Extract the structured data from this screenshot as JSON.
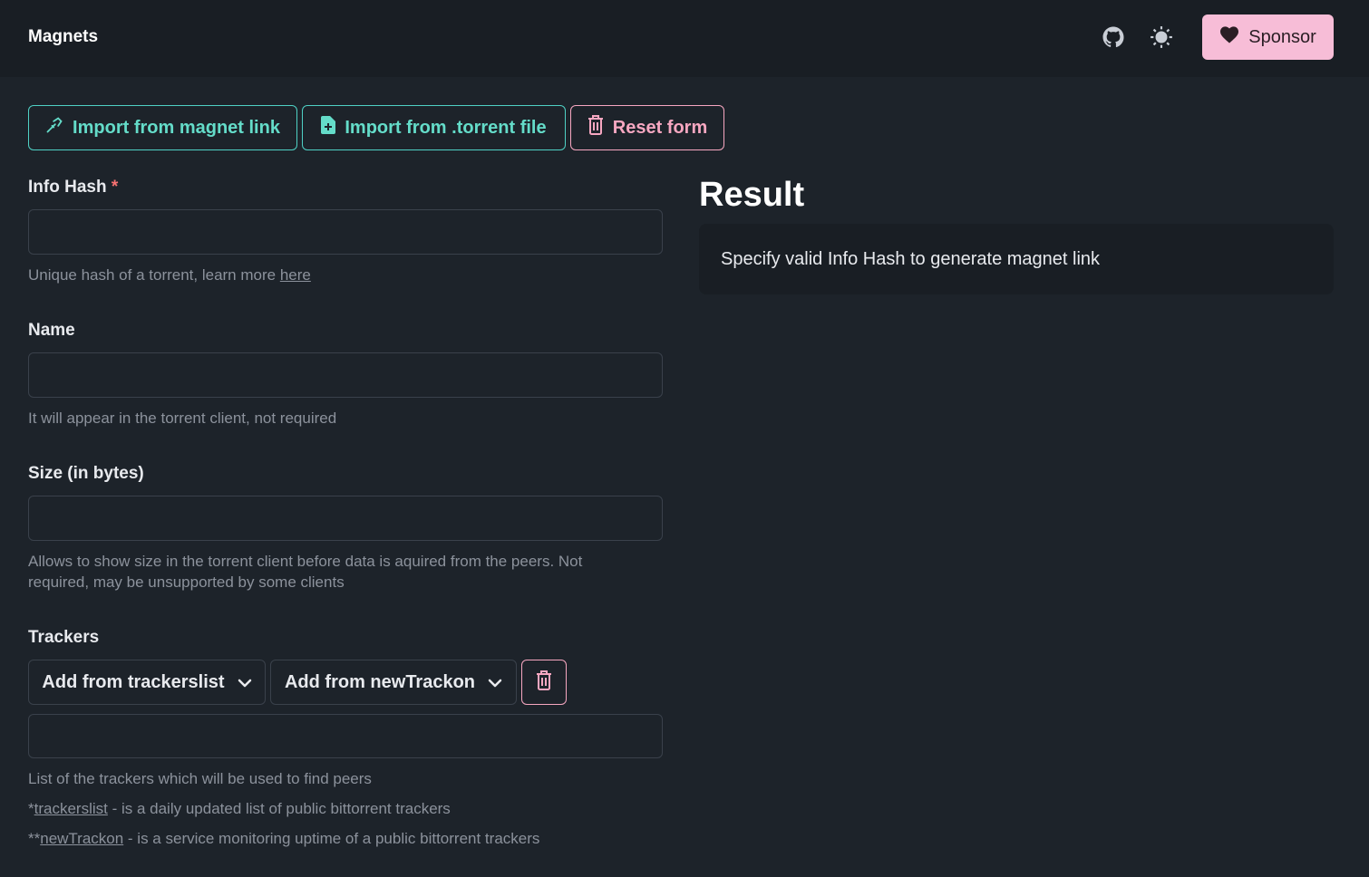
{
  "navbar": {
    "brand": "Magnets",
    "github_icon": "github-icon",
    "theme_icon": "sun-icon",
    "sponsor_label": "Sponsor",
    "sponsor_icon": "heart-icon"
  },
  "actions": {
    "import_magnet_label": "Import from magnet link",
    "import_torrent_label": "Import from .torrent file",
    "reset_label": "Reset form"
  },
  "form": {
    "info_hash": {
      "label": "Info Hash",
      "required_mark": "*",
      "value": "",
      "help_text": "Unique hash of a torrent, learn more ",
      "help_link": "here"
    },
    "name": {
      "label": "Name",
      "value": "",
      "help_text": "It will appear in the torrent client, not required"
    },
    "size": {
      "label": "Size (in bytes)",
      "value": "",
      "help_line1": "Allows to show size in the torrent client before data is aquired from the peers. Not",
      "help_line2": "required, may be unsupported by some clients"
    },
    "trackers": {
      "label": "Trackers",
      "add_trackerslist_label": "Add from trackerslist",
      "add_newtrackon_label": "Add from newTrackon",
      "value": "",
      "help_text": "List of the trackers which will be used to find peers",
      "note1_prefix": "*",
      "note1_link": "trackerslist",
      "note1_text": " - is a daily updated list of public bittorrent trackers",
      "note2_prefix": "**",
      "note2_link": "newTrackon",
      "note2_text": " - is a service monitoring uptime of a public bittorrent trackers"
    }
  },
  "result": {
    "title": "Result",
    "message": "Specify valid Info Hash to generate magnet link"
  },
  "colors": {
    "background": "#1d232a",
    "navbar": "#191e24",
    "accent_teal": "#64dcc9",
    "accent_pink": "#f7a7c1",
    "sponsor_bg": "#f7bdd7"
  }
}
